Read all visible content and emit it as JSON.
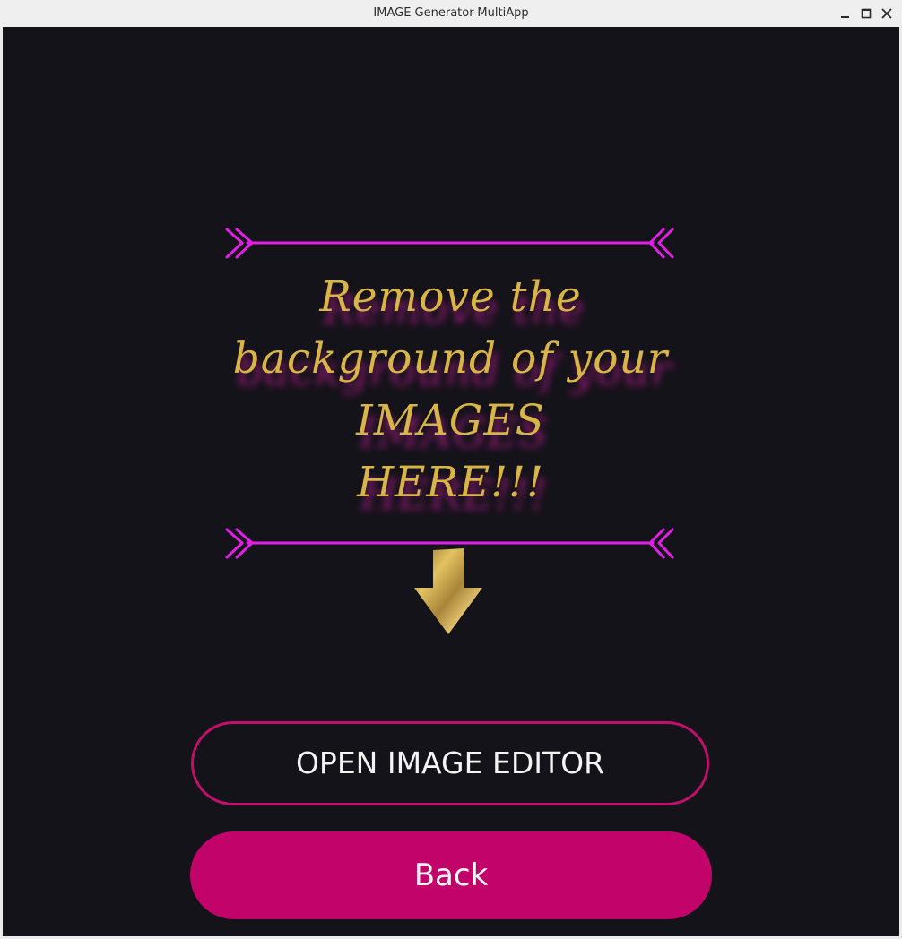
{
  "window": {
    "title": "IMAGE Generator-MultiApp",
    "controls": [
      "minimize-icon",
      "maximize-icon",
      "close-icon"
    ]
  },
  "banner": {
    "headline_lines": [
      "Remove the",
      "background of your",
      "IMAGES",
      "HERE!!!"
    ],
    "decoration": [
      "double-chevron-arrow-line-top",
      "double-chevron-arrow-line-bottom",
      "arrow-down-icon"
    ]
  },
  "actions": {
    "open_editor_label": "OPEN IMAGE EDITOR",
    "back_label": "Back"
  },
  "colors": {
    "background": "#15131a",
    "accent_magenta": "#e21ee6",
    "button_pink": "#c2036a",
    "gold": "#d9b547",
    "text_light": "#f4f4f4"
  }
}
